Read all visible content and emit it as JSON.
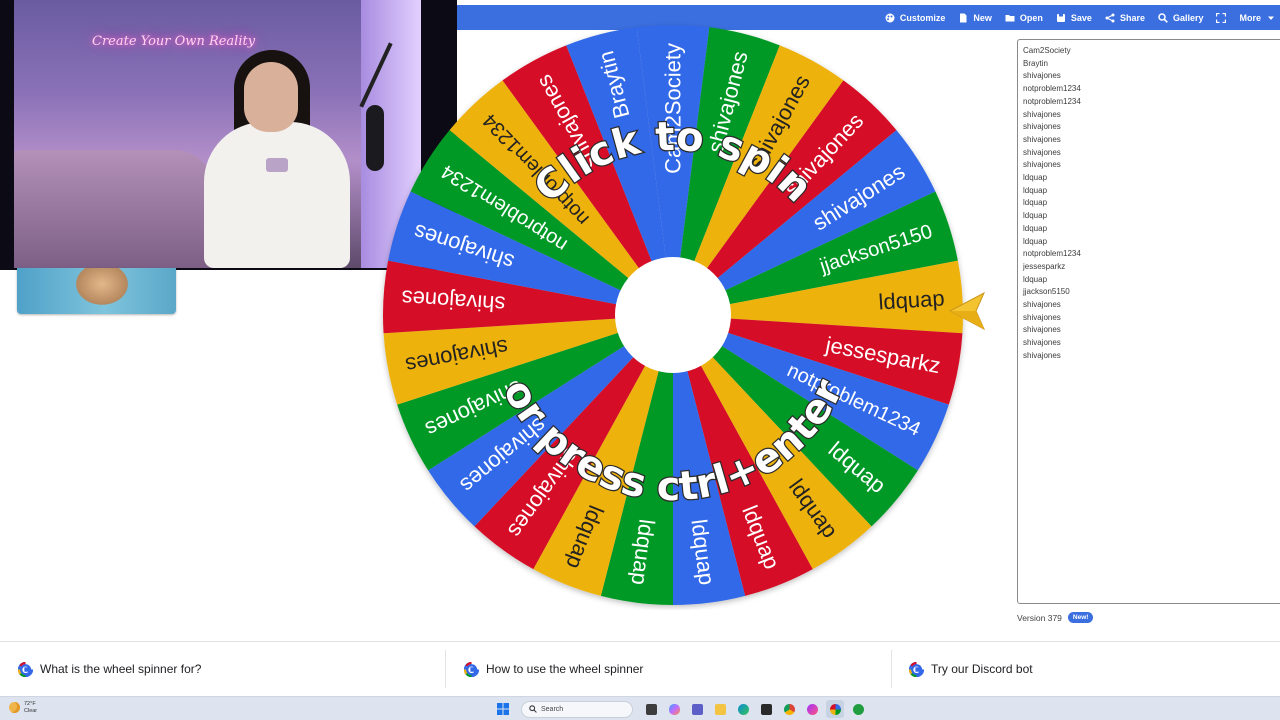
{
  "toolbar": {
    "items": [
      {
        "label": "Customize",
        "icon": "palette-icon"
      },
      {
        "label": "New",
        "icon": "new-file-icon"
      },
      {
        "label": "Open",
        "icon": "folder-open-icon"
      },
      {
        "label": "Save",
        "icon": "save-icon"
      },
      {
        "label": "Share",
        "icon": "share-icon"
      },
      {
        "label": "Gallery",
        "icon": "search-icon"
      },
      {
        "label": "",
        "icon": "fullscreen-icon"
      },
      {
        "label": "More",
        "icon": "caret-down-icon"
      }
    ]
  },
  "webcam": {
    "neon_text": "Create Your Own Reality"
  },
  "wheel": {
    "center_text_top": "Click to spin",
    "center_text_bottom": "or press ctrl+enter",
    "colors": [
      "#3369e8",
      "#009925",
      "#eeb211",
      "#d50f25"
    ],
    "segments": [
      "Cam2Society",
      "shivajones",
      "shivajones",
      "shivajones",
      "shivajones",
      "jjackson5150",
      "ldquap",
      "jessesparkz",
      "notproblem1234",
      "ldquap",
      "ldquap",
      "ldquap",
      "ldquap",
      "ldquap",
      "ldquap",
      "shivajones",
      "shivajones",
      "shivajones",
      "shivajones",
      "shivajones",
      "shivajones",
      "notproblem1234",
      "notproblem1234",
      "shivajones",
      "Braytin"
    ]
  },
  "entries": {
    "lines": [
      "Cam2Society",
      "Braytin",
      "shivajones",
      "notproblem1234",
      "notproblem1234",
      "shivajones",
      "shivajones",
      "shivajones",
      "shivajones",
      "shivajones",
      "ldquap",
      "ldquap",
      "ldquap",
      "ldquap",
      "ldquap",
      "ldquap",
      "notproblem1234",
      "jessesparkz",
      "ldquap",
      "jjackson5150",
      "shivajones",
      "shivajones",
      "shivajones",
      "shivajones",
      "shivajones"
    ]
  },
  "version": {
    "label": "Version 379",
    "badge": "New!"
  },
  "faq": {
    "items": [
      "What is the wheel spinner for?",
      "How to use the wheel spinner",
      "Try our Discord bot"
    ]
  },
  "taskbar": {
    "temperature": "72°F",
    "condition": "Clear",
    "search_placeholder": "Search"
  }
}
